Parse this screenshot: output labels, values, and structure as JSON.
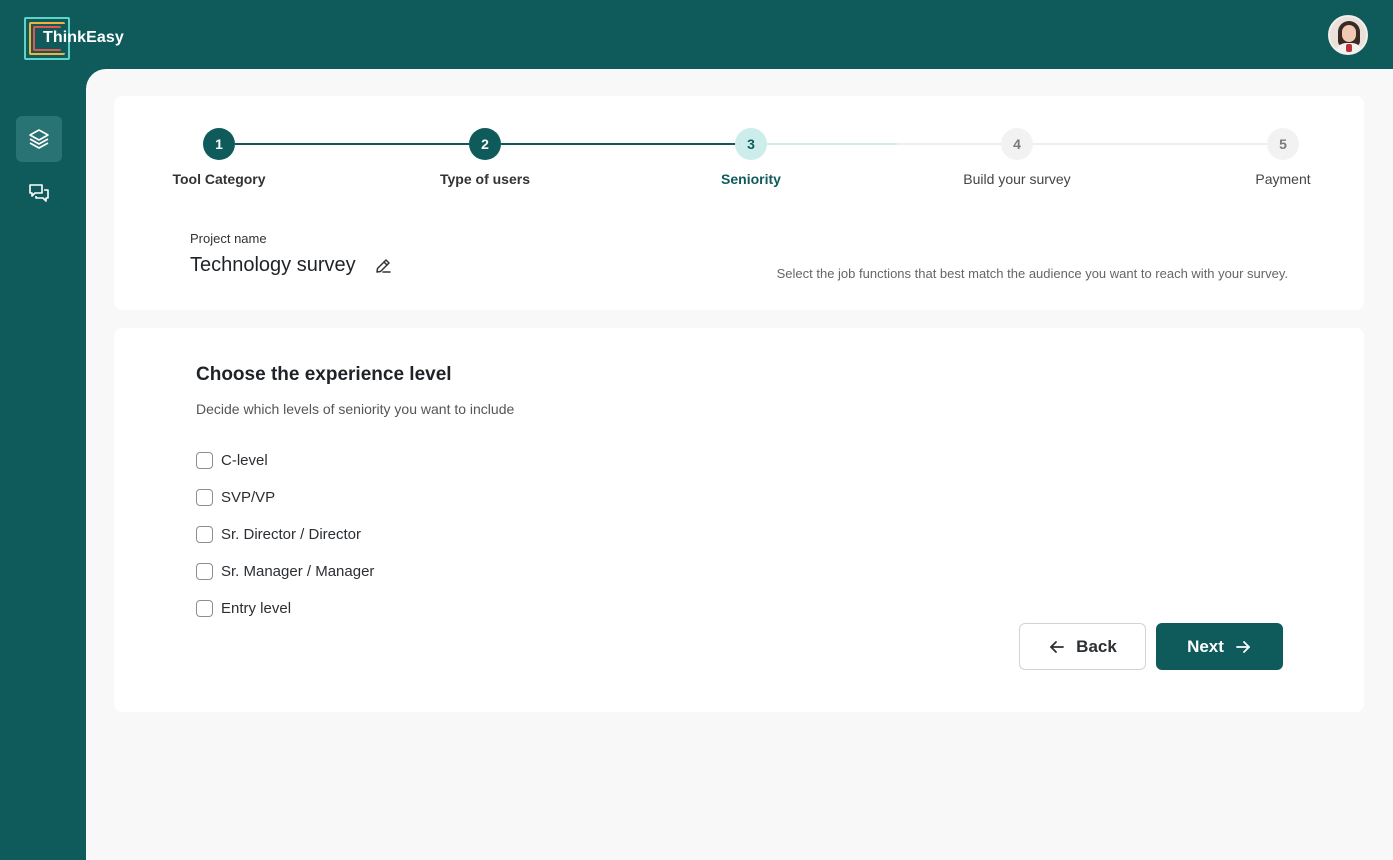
{
  "app": {
    "brand": "ThinkEasy",
    "avatar_icon": "user-avatar"
  },
  "colors": {
    "primary": "#0f5b5c",
    "current_step_bg": "#cdecec",
    "page_bg": "#f8f8f8"
  },
  "sidebar": {
    "items": [
      {
        "icon": "layers-icon",
        "active": true
      },
      {
        "icon": "chat-bubbles-icon",
        "active": false
      }
    ]
  },
  "stepper": {
    "steps": [
      {
        "number": "1",
        "label": "Tool Category",
        "state": "done"
      },
      {
        "number": "2",
        "label": "Type of users",
        "state": "done"
      },
      {
        "number": "3",
        "label": "Seniority",
        "state": "current"
      },
      {
        "number": "4",
        "label": "Build your survey",
        "state": "todo"
      },
      {
        "number": "5",
        "label": "Payment",
        "state": "todo"
      }
    ]
  },
  "project": {
    "label": "Project name",
    "name": "Technology survey",
    "hint": "Select the job functions that best match the audience you want to reach with your survey."
  },
  "experience": {
    "title": "Choose the experience level",
    "subtitle": "Decide which levels of seniority you want to include",
    "options": [
      {
        "label": "C-level",
        "checked": false
      },
      {
        "label": "SVP/VP",
        "checked": false
      },
      {
        "label": "Sr. Director / Director",
        "checked": false
      },
      {
        "label": "Sr. Manager / Manager",
        "checked": false
      },
      {
        "label": "Entry level",
        "checked": false
      }
    ]
  },
  "actions": {
    "back_label": "Back",
    "next_label": "Next"
  }
}
